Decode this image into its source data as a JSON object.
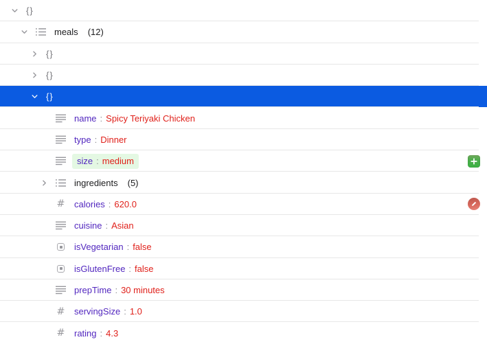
{
  "ui": {
    "colon": ":",
    "number_icon_glyph": "#"
  },
  "colors": {
    "selection_blue": "#0b5be1",
    "key_purple": "#5227bf",
    "value_red": "#e0211b",
    "container_key_black": "#1c1c1e",
    "braces_gray": "#76767b",
    "muted_gray": "#8e8e93",
    "icon_gray": "#98989d",
    "separator": "#e7e7e7",
    "highlight_green_bg": "#e4f8e3",
    "add_button_green": "#43b145",
    "edit_button_red": "#d4574c"
  },
  "tree": {
    "rows": [
      {
        "level": 0,
        "chevron": "down",
        "label": "{}",
        "kind": "object"
      },
      {
        "level": 1,
        "chevron": "down",
        "icon": "list",
        "key": "meals",
        "count": "(12)",
        "kind": "array"
      },
      {
        "level": 2,
        "chevron": "right",
        "label": "{}",
        "kind": "object"
      },
      {
        "level": 2,
        "chevron": "right",
        "label": "{}",
        "kind": "object"
      },
      {
        "level": 2,
        "chevron": "down",
        "label": "{}",
        "kind": "object",
        "selected": true
      },
      {
        "level": 3,
        "icon": "text",
        "key": "name",
        "value": "Spicy Teriyaki Chicken"
      },
      {
        "level": 3,
        "icon": "text",
        "key": "type",
        "value": "Dinner"
      },
      {
        "level": 3,
        "icon": "text",
        "key": "size",
        "value": "medium",
        "highlighted": true,
        "action": "add"
      },
      {
        "level": 3,
        "chevron": "right",
        "icon": "list",
        "key": "ingredients",
        "count": "(5)",
        "kind": "array"
      },
      {
        "level": 3,
        "icon": "number",
        "key": "calories",
        "value": "620.0",
        "action": "edit"
      },
      {
        "level": 3,
        "icon": "text",
        "key": "cuisine",
        "value": "Asian"
      },
      {
        "level": 3,
        "icon": "boolean",
        "key": "isVegetarian",
        "value": "false"
      },
      {
        "level": 3,
        "icon": "boolean",
        "key": "isGlutenFree",
        "value": "false"
      },
      {
        "level": 3,
        "icon": "text",
        "key": "prepTime",
        "value": "30 minutes"
      },
      {
        "level": 3,
        "icon": "number",
        "key": "servingSize",
        "value": "1.0"
      },
      {
        "level": 3,
        "icon": "number",
        "key": "rating",
        "value": "4.3"
      }
    ]
  }
}
